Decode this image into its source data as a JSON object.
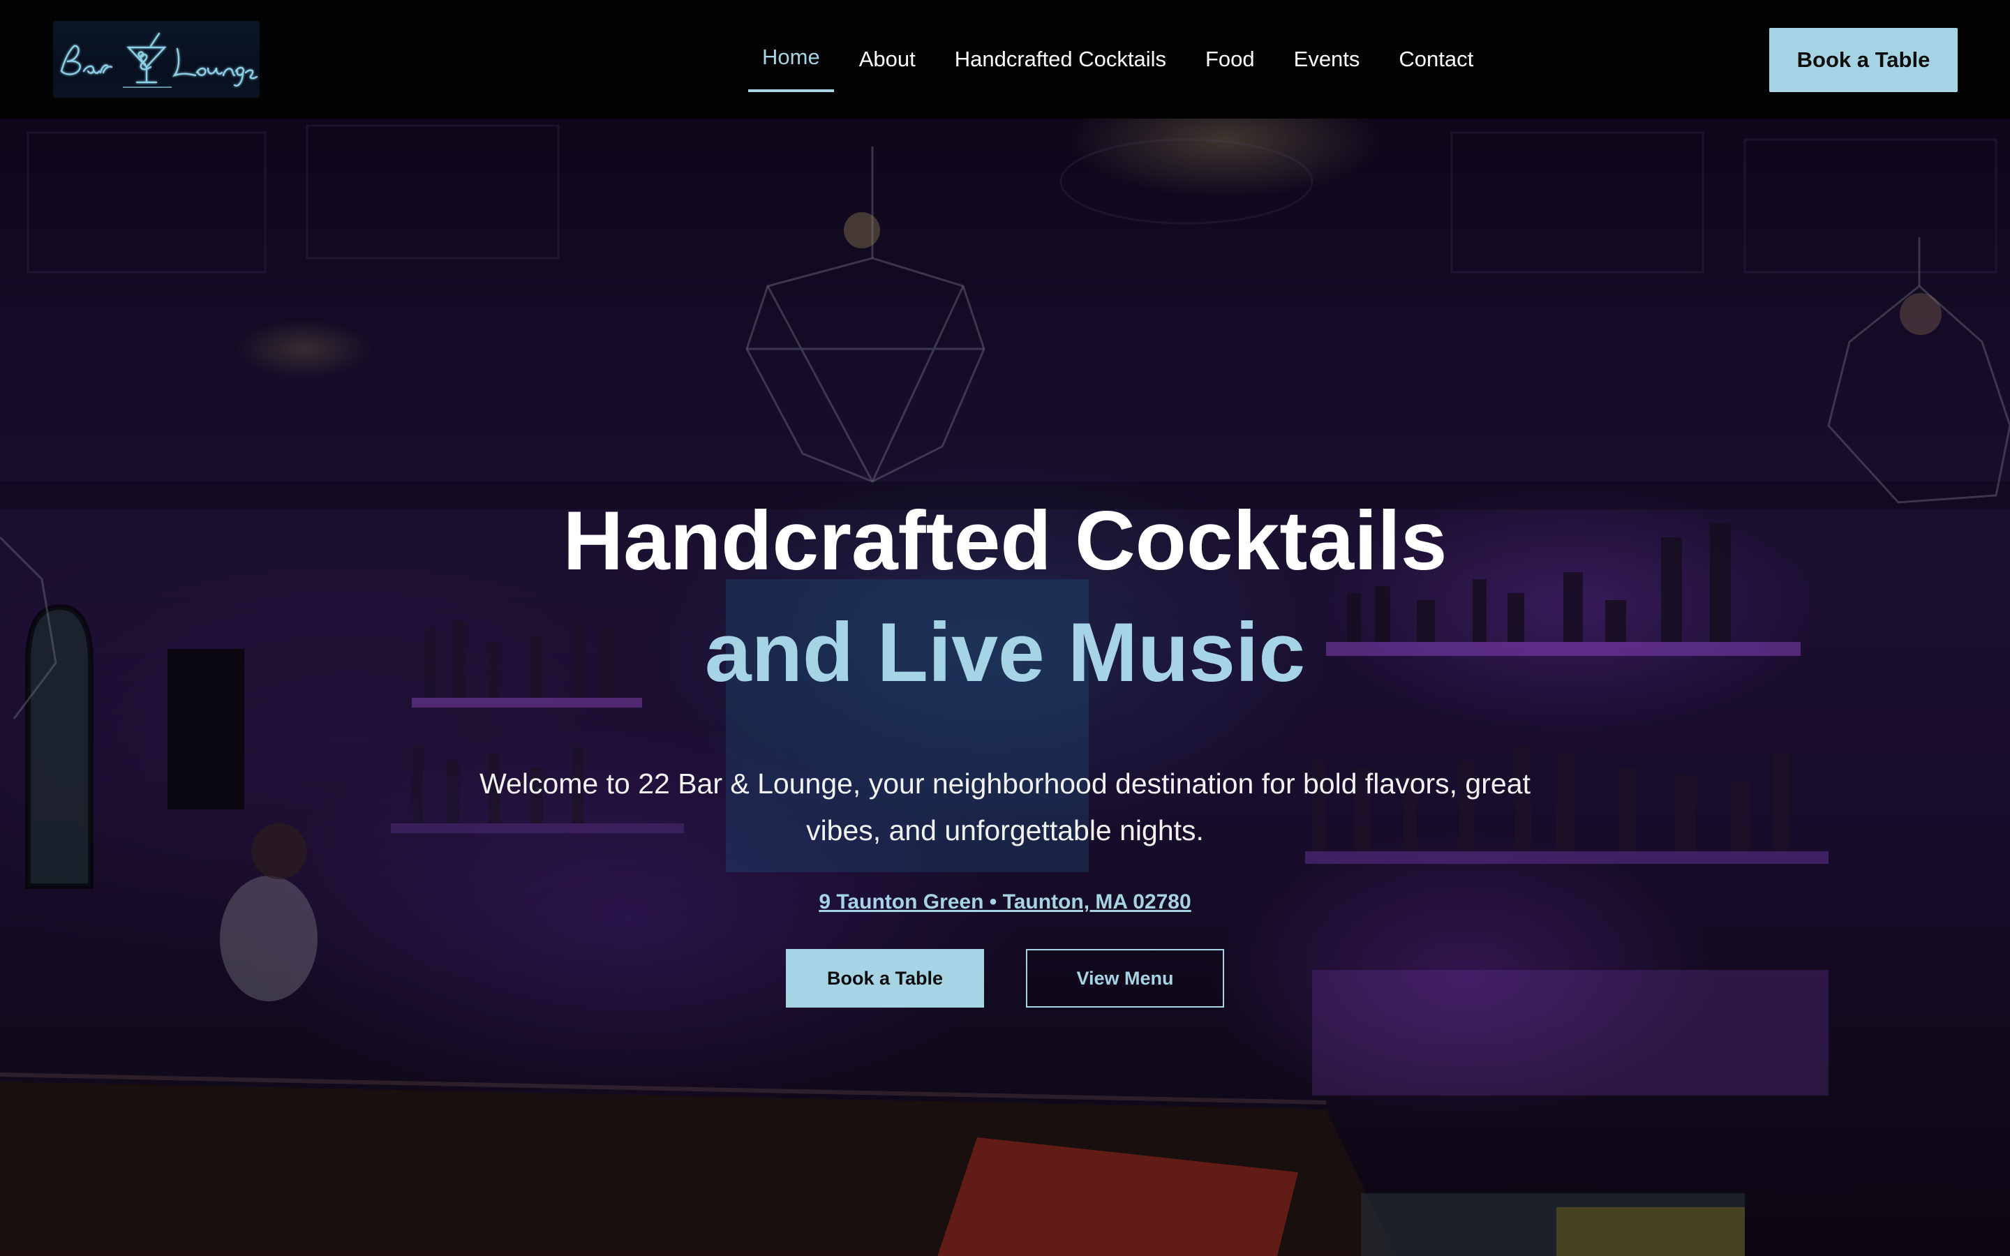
{
  "brand": {
    "logo_text": "Bar & Lounge",
    "logo_color": "#8fd3ea"
  },
  "nav": {
    "items": [
      {
        "label": "Home",
        "active": true
      },
      {
        "label": "About",
        "active": false
      },
      {
        "label": "Handcrafted Cocktails",
        "active": false
      },
      {
        "label": "Food",
        "active": false
      },
      {
        "label": "Events",
        "active": false
      },
      {
        "label": "Contact",
        "active": false
      }
    ],
    "cta_label": "Book a Table"
  },
  "hero": {
    "headline_line1": "Handcrafted Cocktails",
    "headline_line2": "and Live Music",
    "subtitle": "Welcome to 22 Bar & Lounge, your neighborhood destination for bold flavors, great vibes, and unforgettable nights.",
    "address": "9 Taunton Green • Taunton, MA 02780",
    "primary_button": "Book a Table",
    "secondary_button": "View Menu"
  },
  "colors": {
    "accent": "#a6d4e5",
    "header_bg": "#030303",
    "text": "#ffffff"
  }
}
